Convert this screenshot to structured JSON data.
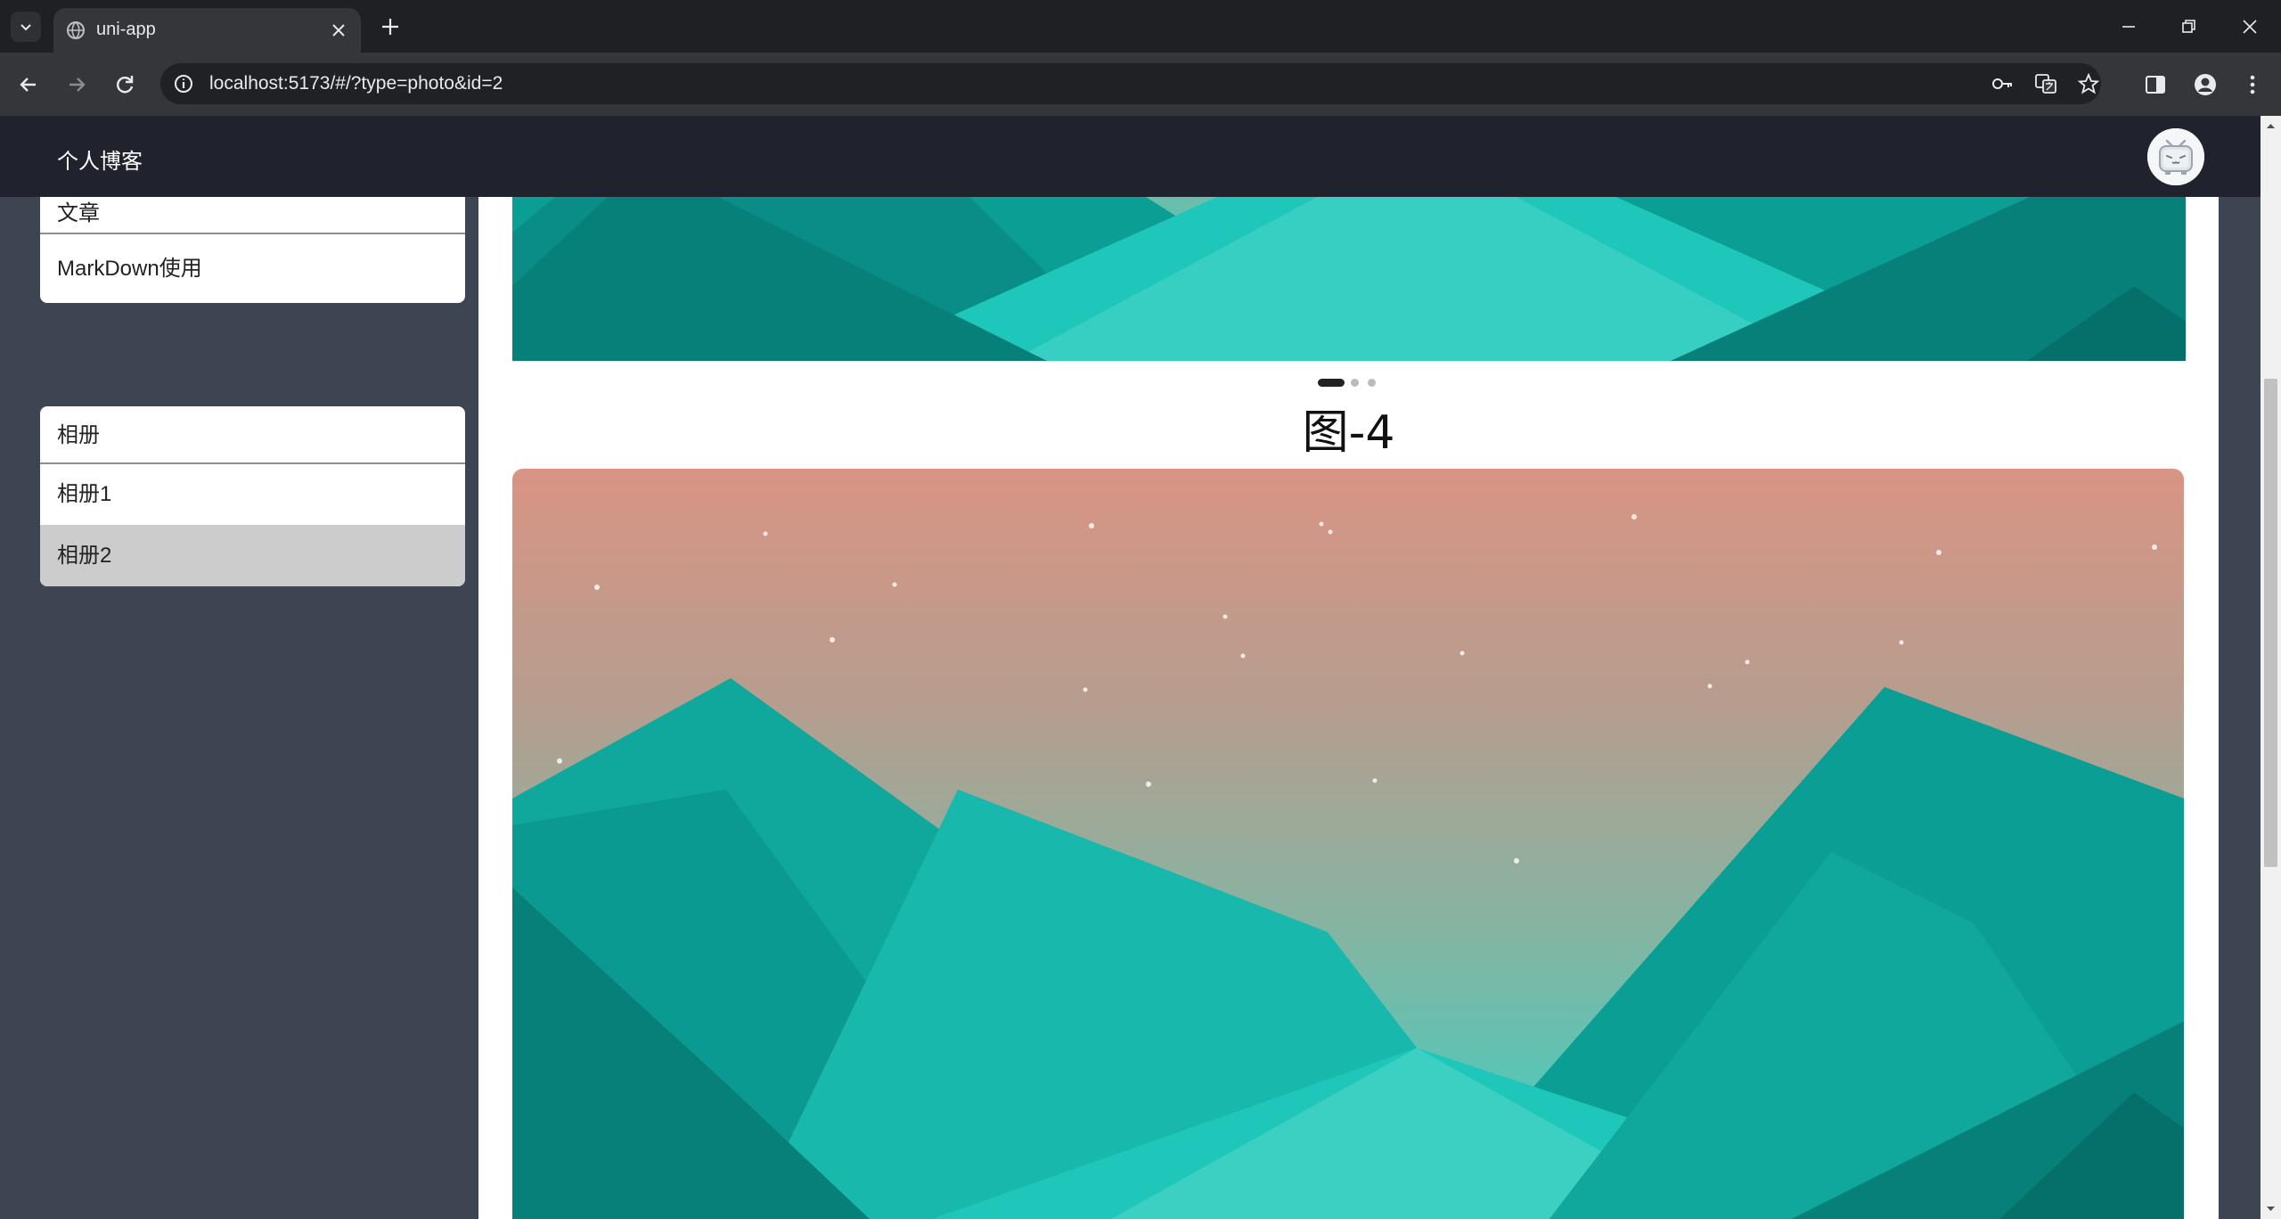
{
  "browser": {
    "tab_title": "uni-app",
    "url_host": "localhost",
    "url_rest": ":5173/#/?type=photo&id=2"
  },
  "app": {
    "title": "个人博客"
  },
  "sidebar": {
    "articles_card": {
      "header_partial": "文章",
      "items": [
        {
          "label": "MarkDown使用"
        }
      ]
    },
    "album_card": {
      "header": "相册",
      "items": [
        {
          "label": "相册1",
          "active": false
        },
        {
          "label": "相册2",
          "active": true
        }
      ]
    }
  },
  "main": {
    "carousel": {
      "count": 3,
      "active_index": 0
    },
    "photo_title": "图-4"
  },
  "colors": {
    "header_bg": "#20232e",
    "sidebar_bg": "#3d4452",
    "active_item_bg": "#cccccc",
    "teal": "#1fc6ba",
    "sky_top": "#d99484"
  }
}
